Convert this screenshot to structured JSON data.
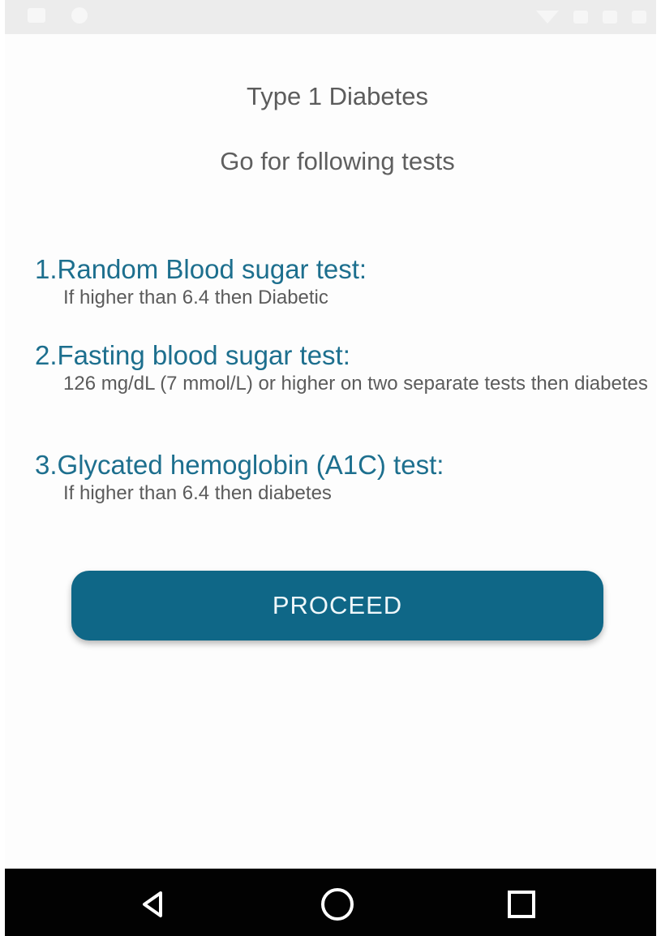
{
  "content": {
    "title": "Type 1 Diabetes",
    "subtitle": "Go for following tests",
    "tests": [
      {
        "title": "1.Random Blood sugar test:",
        "description": "If higher than 6.4 then Diabetic"
      },
      {
        "title": "2.Fasting blood sugar test:",
        "description": "126 mg/dL (7 mmol/L) or higher on two separate tests then diabetes"
      },
      {
        "title": "3.Glycated hemoglobin (A1C) test:",
        "description": "If higher than 6.4 then diabetes"
      }
    ],
    "proceed_label": "PROCEED"
  },
  "colors": {
    "accent": "#0f6787",
    "heading_text": "#1d6f8e",
    "body_text": "#5b5b5b",
    "nav_background": "#020202",
    "status_background": "#ececec"
  },
  "icons": {
    "status_left": [
      "notification-icon",
      "notification-icon"
    ],
    "status_right": [
      "wifi-icon",
      "signal-icon",
      "signal-icon",
      "battery-icon"
    ],
    "navigation": [
      "back-icon",
      "home-icon",
      "recent-apps-icon"
    ]
  }
}
